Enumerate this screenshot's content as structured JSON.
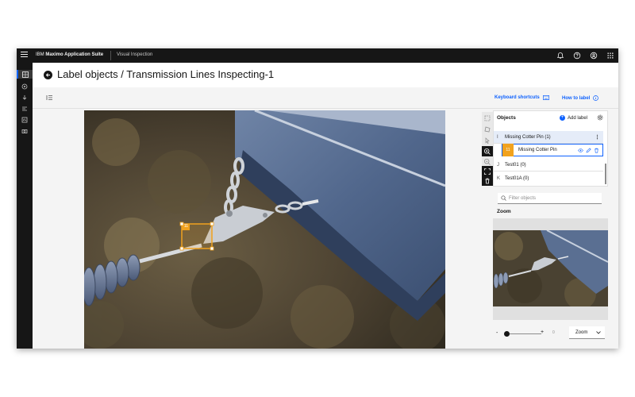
{
  "topbar": {
    "brand_prefix": "IBM",
    "brand_name": "Maximo Application Suite",
    "product": "Visual Inspection",
    "icons": [
      "notification-icon",
      "help-icon",
      "user-icon",
      "app-switcher-icon"
    ]
  },
  "header": {
    "title": "Label objects / Transmission Lines Inspecting-1"
  },
  "toolbar": {
    "keyboard_shortcuts": "Keyboard shortcuts",
    "how_to_label": "How to label"
  },
  "canvas": {
    "box_tag": "11"
  },
  "objects": {
    "title": "Objects",
    "add_label": "Add label",
    "rows": [
      {
        "key": "I",
        "label": "Missing Cotter Pin (1)"
      },
      {
        "key": "J",
        "label": "Test01 (0)"
      },
      {
        "key": "K",
        "label": "Test01A (0)"
      }
    ],
    "sub_row": {
      "tag": "11",
      "label": "Missing Cotter Pin"
    }
  },
  "filter": {
    "placeholder": "Filter objects"
  },
  "zoom": {
    "title": "Zoom",
    "minus": "-",
    "plus": "+",
    "value": "0",
    "select_value": "Zoom"
  },
  "colors": {
    "accent": "#0f62fe",
    "box": "#f1a21e",
    "topbar": "#161616"
  }
}
